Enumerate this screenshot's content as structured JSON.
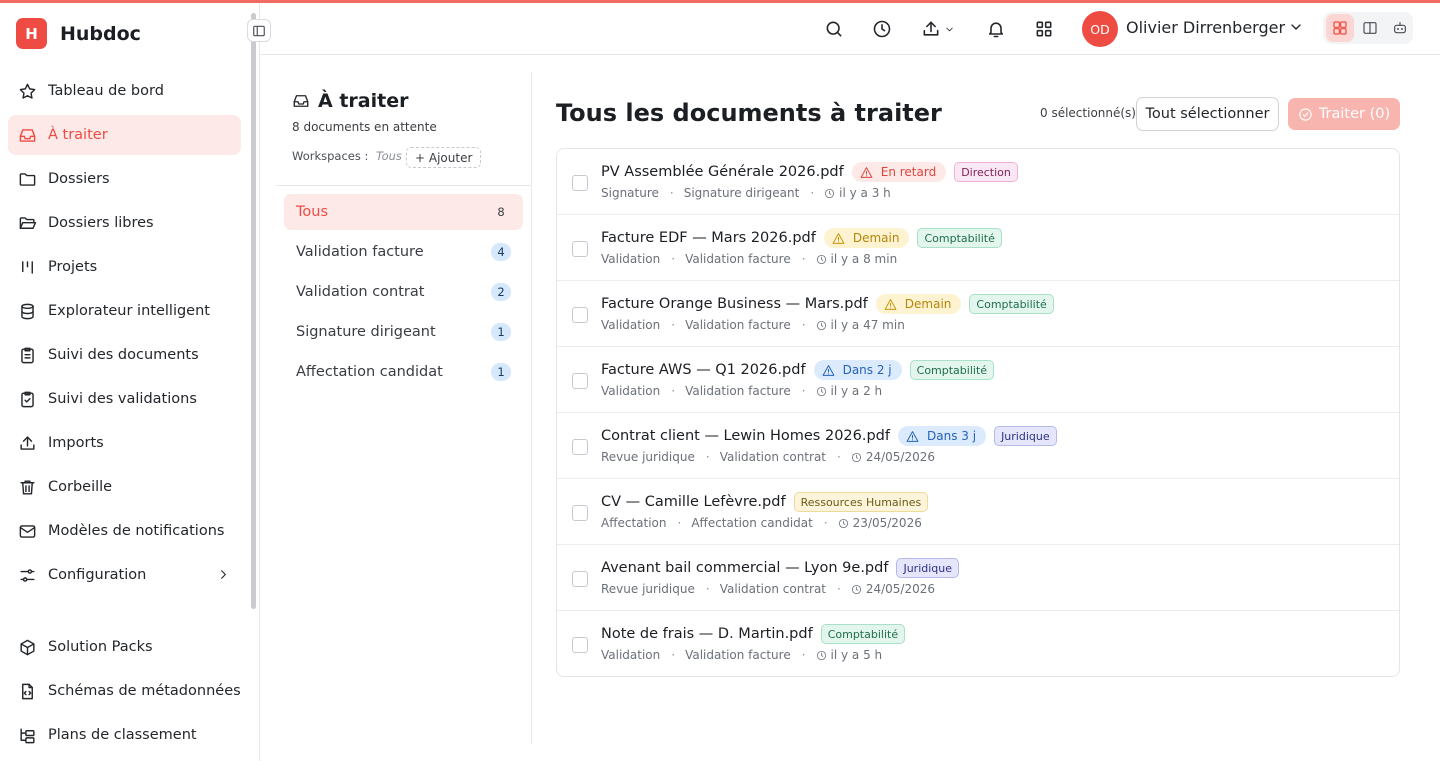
{
  "app": {
    "name": "Hubdoc",
    "logo_letter": "H",
    "accent": "#ee4b43"
  },
  "sidebar": {
    "items": [
      {
        "label": "Tableau de bord",
        "icon": "star-icon"
      },
      {
        "label": "À traiter",
        "icon": "inbox-icon",
        "active": true
      },
      {
        "label": "Dossiers",
        "icon": "folder-icon"
      },
      {
        "label": "Dossiers libres",
        "icon": "folder-open-icon"
      },
      {
        "label": "Projets",
        "icon": "kanban-icon"
      },
      {
        "label": "Explorateur intelligent",
        "icon": "database-icon"
      },
      {
        "label": "Suivi des documents",
        "icon": "clipboard-list-icon"
      },
      {
        "label": "Suivi des validations",
        "icon": "clipboard-check-icon"
      },
      {
        "label": "Imports",
        "icon": "upload-icon"
      },
      {
        "label": "Corbeille",
        "icon": "trash-icon"
      },
      {
        "label": "Modèles de notifications",
        "icon": "mail-icon"
      },
      {
        "label": "Configuration",
        "icon": "sliders-icon"
      },
      {
        "label": "Solution Packs",
        "icon": "package-icon"
      },
      {
        "label": "Schémas de métadonnées",
        "icon": "file-code-icon"
      },
      {
        "label": "Plans de classement",
        "icon": "folder-tree-icon"
      }
    ]
  },
  "topbar": {
    "user": {
      "initials": "OD",
      "name": "Olivier Dirrenberger"
    },
    "icons": [
      "search-icon",
      "history-icon",
      "upload-icon",
      "bell-icon",
      "apps-grid-icon"
    ]
  },
  "panel": {
    "title": "À traiter",
    "subtitle": "8 documents en attente",
    "workspaces_label": "Workspaces :",
    "workspaces_value": "Tous",
    "add_label": "+ Ajouter",
    "filters": [
      {
        "label": "Tous",
        "count": "8",
        "active": true
      },
      {
        "label": "Validation facture",
        "count": "4"
      },
      {
        "label": "Validation contrat",
        "count": "2"
      },
      {
        "label": "Signature dirigeant",
        "count": "1"
      },
      {
        "label": "Affectation candidat",
        "count": "1"
      }
    ]
  },
  "main": {
    "title": "Tous les documents à traiter",
    "selected_count": "0 sélectionné(s)",
    "select_all": "Tout sélectionner",
    "process": "Traiter (0)",
    "documents": [
      {
        "name": "PV Assemblée Générale 2026.pdf",
        "status": {
          "label": "En retard",
          "kind": "late"
        },
        "tag": {
          "label": "Direction",
          "kind": "direction"
        },
        "type": "Signature",
        "step": "Signature dirigeant",
        "time": "il y a 3 h",
        "time_icon": "clock-icon"
      },
      {
        "name": "Facture EDF — Mars 2026.pdf",
        "status": {
          "label": "Demain",
          "kind": "soon"
        },
        "tag": {
          "label": "Comptabilité",
          "kind": "compta"
        },
        "type": "Validation",
        "step": "Validation facture",
        "time": "il y a 8 min",
        "time_icon": "clock-icon"
      },
      {
        "name": "Facture Orange Business — Mars.pdf",
        "status": {
          "label": "Demain",
          "kind": "soon"
        },
        "tag": {
          "label": "Comptabilité",
          "kind": "compta"
        },
        "type": "Validation",
        "step": "Validation facture",
        "time": "il y a 47 min",
        "time_icon": "clock-icon"
      },
      {
        "name": "Facture AWS — Q1 2026.pdf",
        "status": {
          "label": "Dans 2 j",
          "kind": "info"
        },
        "tag": {
          "label": "Comptabilité",
          "kind": "compta"
        },
        "type": "Validation",
        "step": "Validation facture",
        "time": "il y a 2 h",
        "time_icon": "clock-icon"
      },
      {
        "name": "Contrat client — Lewin Homes 2026.pdf",
        "status": {
          "label": "Dans 3 j",
          "kind": "info"
        },
        "tag": {
          "label": "Juridique",
          "kind": "juridique"
        },
        "type": "Revue juridique",
        "step": "Validation contrat",
        "time": "24/05/2026",
        "time_icon": "clock-icon"
      },
      {
        "name": "CV — Camille Lefèvre.pdf",
        "status": null,
        "tag": {
          "label": "Ressources Humaines",
          "kind": "rh"
        },
        "type": "Affectation",
        "step": "Affectation candidat",
        "time": "23/05/2026",
        "time_icon": "clock-icon"
      },
      {
        "name": "Avenant bail commercial — Lyon 9e.pdf",
        "status": null,
        "tag": {
          "label": "Juridique",
          "kind": "juridique"
        },
        "type": "Revue juridique",
        "step": "Validation contrat",
        "time": "24/05/2026",
        "time_icon": "clock-icon"
      },
      {
        "name": "Note de frais — D. Martin.pdf",
        "status": null,
        "tag": {
          "label": "Comptabilité",
          "kind": "compta"
        },
        "type": "Validation",
        "step": "Validation facture",
        "time": "il y a 5 h",
        "time_icon": "clock-icon"
      }
    ]
  }
}
